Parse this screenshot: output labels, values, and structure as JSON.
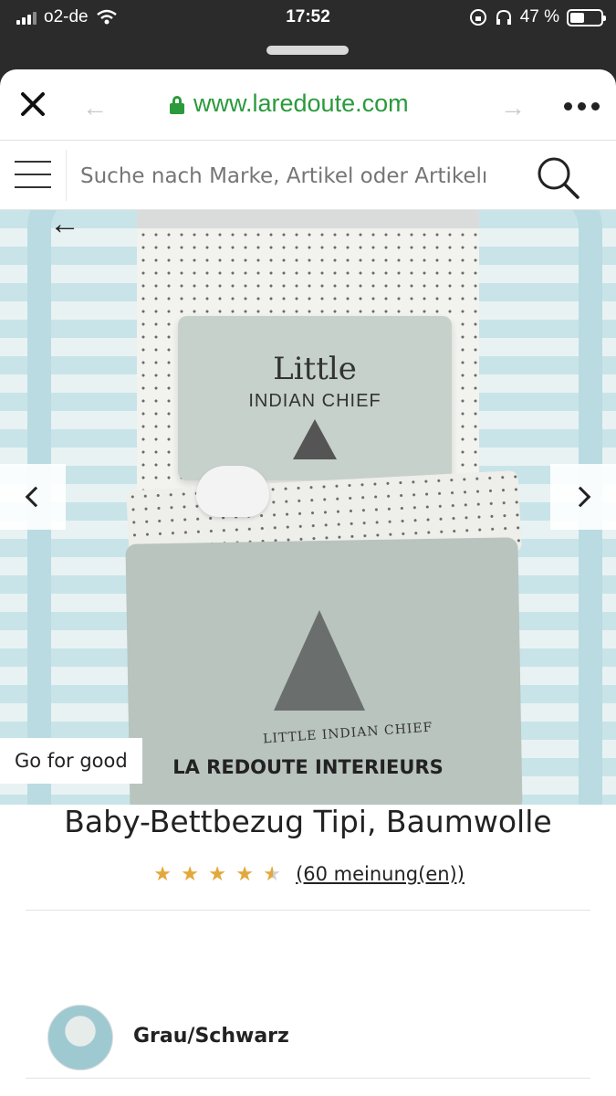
{
  "status_bar": {
    "carrier": "o2-de",
    "time": "17:52",
    "battery": "47 %",
    "battery_level": 0.47
  },
  "browser": {
    "url": "www.laredoute.com"
  },
  "search": {
    "placeholder": "Suche nach Marke, Artikel oder Artikelı"
  },
  "gallery": {
    "badge": "Go for good",
    "pillow_line1": "Little",
    "pillow_line2": "INDIAN CHIEF",
    "duvet_text": "LITTLE INDIAN CHIEF"
  },
  "product": {
    "brand": "LA REDOUTE INTERIEURS",
    "title": "Baby-Bettbezug Tipi, Baumwolle",
    "rating": 4.5,
    "rating_max": 5,
    "reviews": "(60 meinung(en))",
    "color": "Grau/Schwarz"
  },
  "colors": {
    "accent_green": "#2a9a3c",
    "star": "#e4a73a"
  },
  "icons": [
    "wifi-icon",
    "battery-icon",
    "close-icon",
    "back-arrow-icon",
    "forward-arrow-icon",
    "lock-icon",
    "more-icon",
    "hamburger-icon",
    "search-icon",
    "chevron-left-icon",
    "chevron-right-icon",
    "star-icon"
  ]
}
